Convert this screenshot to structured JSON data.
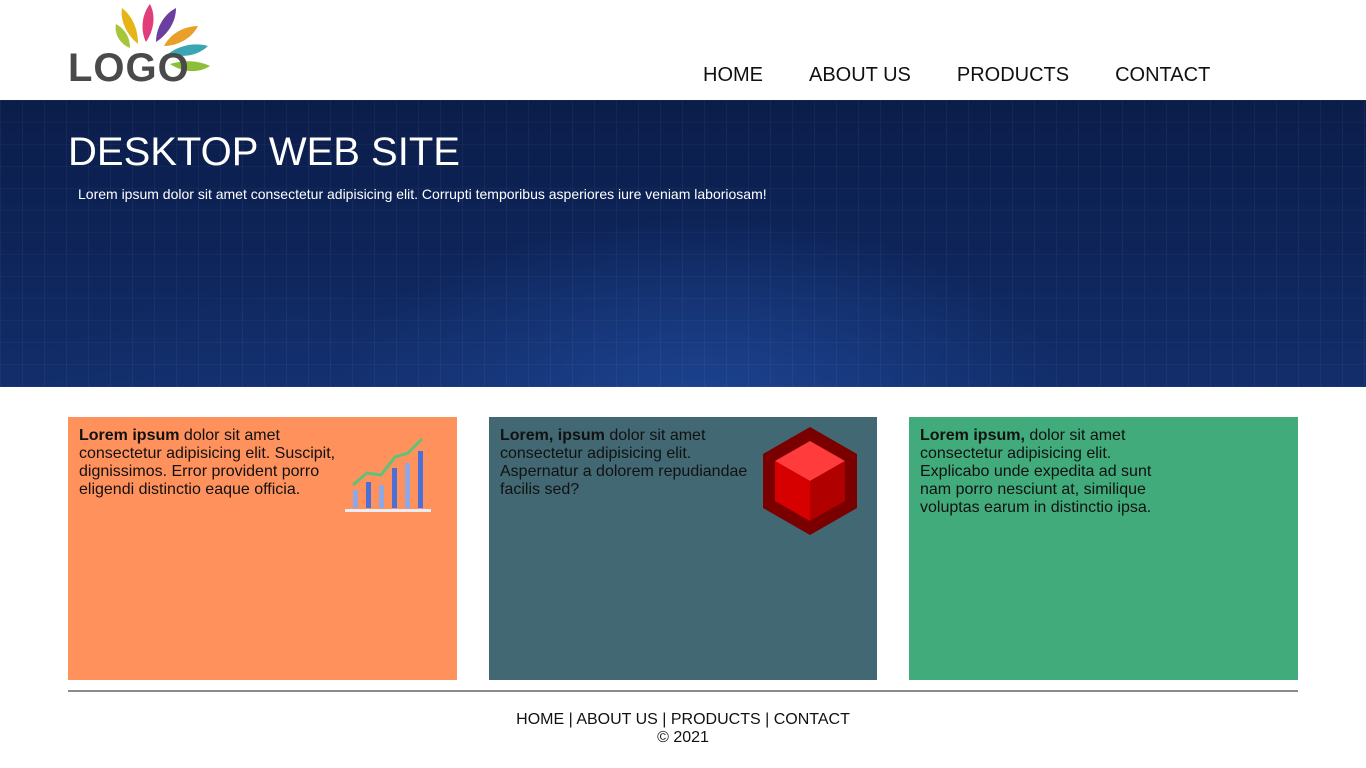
{
  "header": {
    "logo_text": "LOGO",
    "nav": [
      {
        "label": "HOME"
      },
      {
        "label": "ABOUT US"
      },
      {
        "label": "PRODUCTS"
      },
      {
        "label": "CONTACT"
      }
    ]
  },
  "hero": {
    "title": "DESKTOP WEB SITE",
    "subtitle": "Lorem ipsum dolor sit amet consectetur adipisicing elit. Corrupti temporibus asperiores iure veniam laboriosam!"
  },
  "cards": [
    {
      "bold": "Lorem ipsum",
      "text": " dolor sit amet consectetur adipisicing elit. Suscipit, dignissimos. Error provident porro eligendi distinctio eaque officia.",
      "icon": "bar-chart-icon",
      "color": "#ff915d"
    },
    {
      "bold": "Lorem, ipsum",
      "text": " dolor sit amet consectetur adipisicing elit. Aspernatur a dolorem repudiandae facilis sed?",
      "icon": "red-cube-icon",
      "color": "#416873"
    },
    {
      "bold": "Lorem ipsum,",
      "text": " dolor sit amet consectetur adipisicing elit. Explicabo unde expedita ad sunt nam porro nesciunt at, similique voluptas earum in distinctio ipsa.",
      "icon": "",
      "color": "#41ab7c"
    }
  ],
  "footer": {
    "nav": [
      {
        "label": "HOME"
      },
      {
        "label": "ABOUT US"
      },
      {
        "label": "PRODUCTS"
      },
      {
        "label": "CONTACT"
      }
    ],
    "separator": " | ",
    "copyright": "© 2021"
  }
}
